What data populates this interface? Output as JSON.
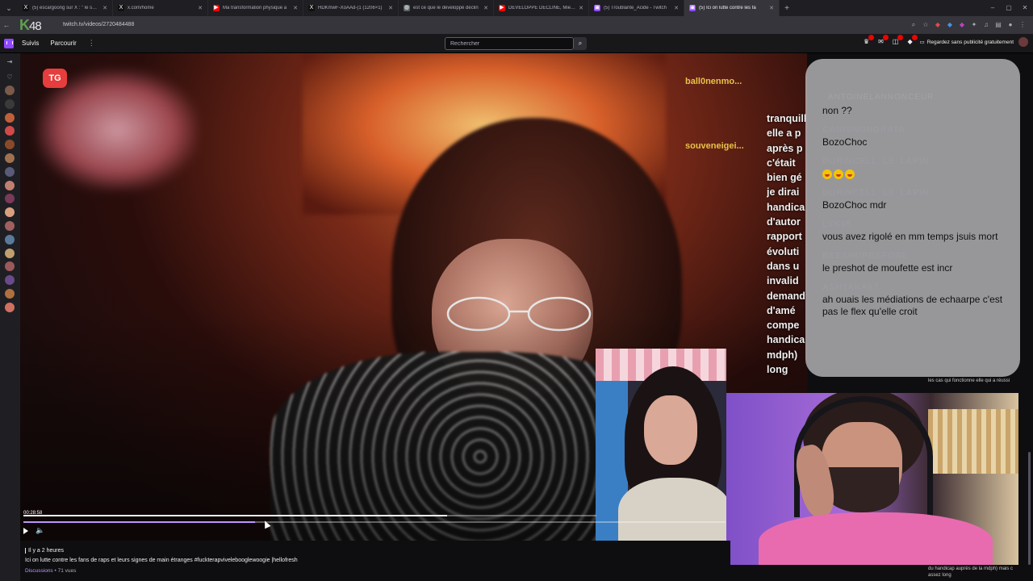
{
  "browser": {
    "tabs": [
      {
        "label": "(5) escargoong sur X : \" le suis p",
        "color": "#111111",
        "glyph": "X"
      },
      {
        "label": "x.com/home",
        "color": "#111111",
        "glyph": "X"
      },
      {
        "label": "Ma transformation physique a",
        "color": "#ff0000",
        "glyph": "▶"
      },
      {
        "label": "HDKmwF-XoAAd-(1 (1206×1)",
        "color": "#111111",
        "glyph": "X"
      },
      {
        "label": "est ce que le développé déclin",
        "color": "#5f6368",
        "glyph": "◍"
      },
      {
        "label": "DÉVELOPPÉ DÉCLINÉ, Mieux q",
        "color": "#ff0000",
        "glyph": "▶"
      },
      {
        "label": "(5) Troublante_Acide - Twitch",
        "color": "#9147ff",
        "glyph": "▣"
      },
      {
        "label": "(5) Ici on lutte contre les fa",
        "color": "#9147ff",
        "glyph": "▣",
        "active": true
      }
    ],
    "new_tab": "+",
    "url": "twitch.tv/videos/2720484488",
    "logo_text": "K",
    "logo_num": "48"
  },
  "nav": {
    "following": "Suivis",
    "browse": "Parcourir",
    "more": "⋮",
    "search_placeholder": "Rechercher",
    "turbo_label": "Regardez sans publicité gratuitement",
    "badges": [
      "",
      "",
      "",
      ""
    ]
  },
  "video": {
    "tg_logo": "TG",
    "subtitle_names": [
      {
        "name": "ball0nenmo..."
      },
      {
        "name": "souveneigei..."
      }
    ],
    "subtitle_lines": [
      "tranquill",
      "elle a p",
      "après p",
      "c'était",
      "bien gé",
      "je dirai",
      "handica",
      "d'autor",
      "rapport",
      "évoluti",
      "dans u",
      "invalid",
      "demand",
      "d'amé",
      "compe",
      "handica",
      "mdph)",
      "long"
    ],
    "timecode": "00:28:58",
    "progress1": 0.74,
    "progress2": 0.33
  },
  "chat": {
    "ghost": "ANTOINELANNONCEUR",
    "messages": [
      {
        "user": "",
        "text": "non ??"
      },
      {
        "user": "CAIUSNONGRATA",
        "text": "BozoChoc"
      },
      {
        "user": "DURINCELL_LE_LAPIN",
        "text": "",
        "emojis": 3
      },
      {
        "user": "DURINCELL_LE_LAPIN",
        "text": "BozoChoc mdr"
      },
      {
        "user": "LVK05",
        "text": "vous avez rigolé en mm temps jsuis mort"
      },
      {
        "user": "BEESHOPBEFORE",
        "text": "le preshot de moufette est incr"
      },
      {
        "user": "ASHTAKA67",
        "text": "ah ouais les médiations de echaarpe c'est pas le flex qu'elle croit"
      }
    ]
  },
  "info": {
    "time": "Il y a 2 heures",
    "title": "Ici on lutte contre les fans de raps et leurs signes de main étranges #fuckterapvivelebooglewoogie |hellofresh",
    "category": "Discussions",
    "views": " • 71 vues"
  },
  "right_panel": {
    "text1": "les cas qui fonctionne elle qui a réussi",
    "text2": "du handicap auprès de la mdph) mais c assez long"
  }
}
